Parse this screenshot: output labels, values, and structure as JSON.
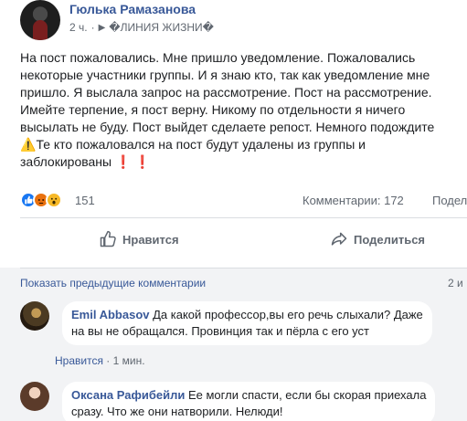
{
  "post": {
    "author": "Гюлька Рамазанова",
    "time": "2 ч.",
    "audience_separator": "·",
    "group": "�ЛИНИЯ ЖИЗНИ�",
    "text_lines": [
      "На пост пожаловались. Мне пришло уведомление. Пожаловались",
      "некоторые участники группы. И я знаю кто, так как уведомление мне",
      "пришло. Я выслала запрос на рассмотрение. Пост на рассмотрение.",
      "Имейте терпение, я пост верну. Никому по отдельности я ничего",
      "высылать не буду. Пост выйдет сделаете репост. Немного подождите",
      "Те кто пожаловался на пост будут удалены из группы и",
      "заблокированы"
    ],
    "warning_glyph": "⚠️",
    "exclamations": "❗ ❗"
  },
  "reactions": {
    "count": "151",
    "comments_label": "Комментарии: 172",
    "shares_label": "Поделились"
  },
  "actions": {
    "like_label": "Нравится",
    "share_label": "Поделиться"
  },
  "comments_section": {
    "show_previous": "Показать предыдущие комментарии",
    "count_indicator": "2 и"
  },
  "comments": [
    {
      "name": "Emil Abbasov",
      "line1": "Да какой профессор,вы его речь слыхали? Даже",
      "line2": "на вы не обращался. Провинция так и пёрла с его уст",
      "like": "Нравится",
      "dot": "·",
      "time": "1 мин."
    },
    {
      "name": "Оксана Рафибейли",
      "line1": "Ее могли спасти, если бы скорая приехала",
      "line2": "сразу. Что же они натворили. Нелюди!"
    }
  ],
  "colors": {
    "link": "#385898",
    "meta": "#606770",
    "like_blue": "#1877f2",
    "angry_orange": "#e9710f",
    "wow_yellow": "#f7b928"
  },
  "icons": [
    "thumbs-up-icon",
    "share-arrow-icon",
    "globe-icon",
    "like-reaction-icon",
    "angry-reaction-icon",
    "wow-reaction-icon"
  ]
}
